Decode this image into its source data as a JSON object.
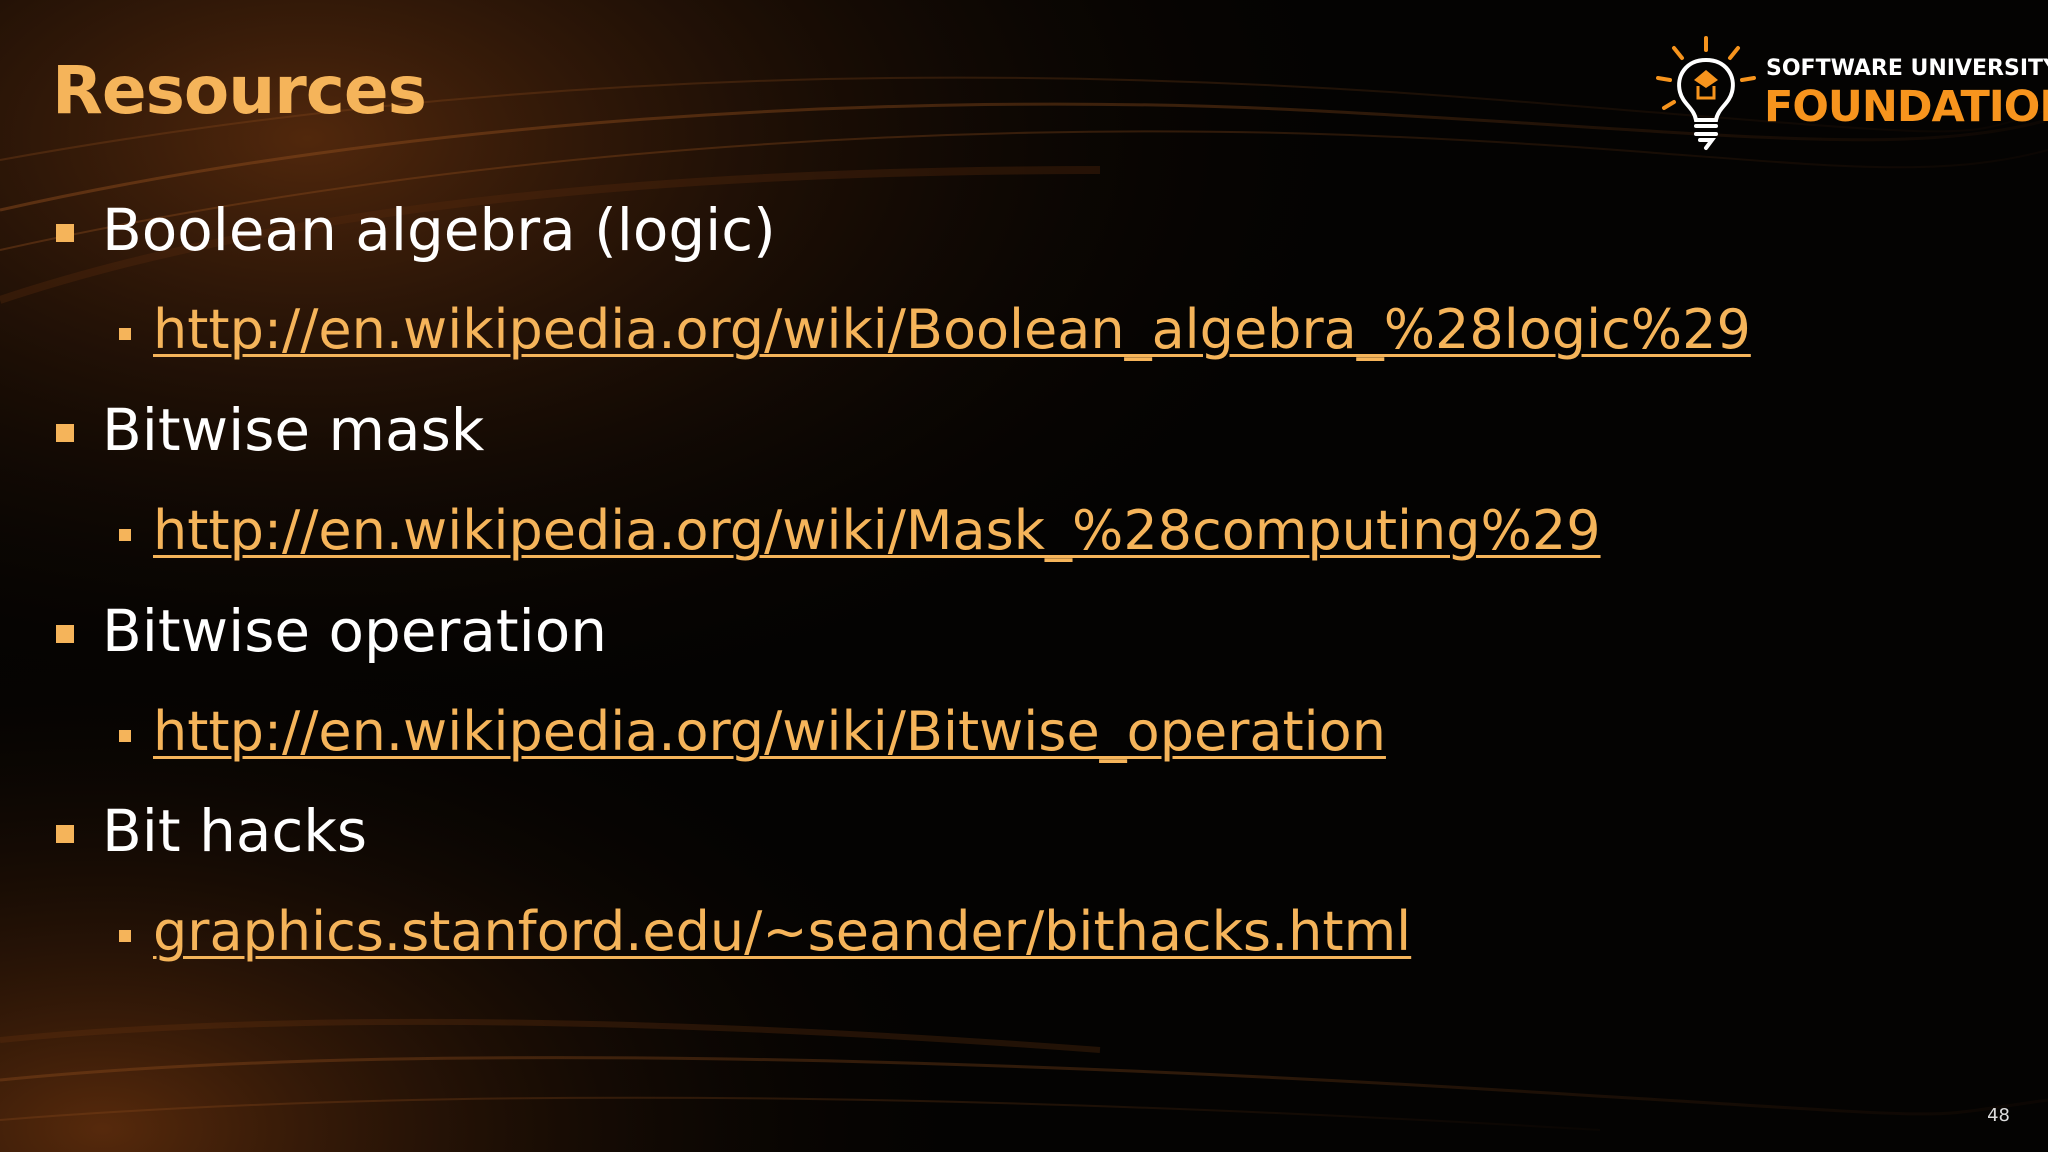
{
  "slide": {
    "title": "Resources",
    "slide_number": "48",
    "accent_color": "#f5b45a",
    "text_color": "#ffffff",
    "background_color": "#040302"
  },
  "logo": {
    "top_text": "SOFTWARE UNIVERSITY",
    "bottom_text": "FOUNDATION",
    "icon": "lightbulb-icon",
    "bottom_color": "#f7941d"
  },
  "items": [
    {
      "label": "Boolean algebra (logic)",
      "link": "http://en.wikipedia.org/wiki/Boolean_algebra_%28logic%29"
    },
    {
      "label": "Bitwise mask",
      "link": "http://en.wikipedia.org/wiki/Mask_%28computing%29"
    },
    {
      "label": "Bitwise operation",
      "link": "http://en.wikipedia.org/wiki/Bitwise_operation"
    },
    {
      "label": "Bit hacks",
      "link": "graphics.stanford.edu/~seander/bithacks.html"
    }
  ]
}
